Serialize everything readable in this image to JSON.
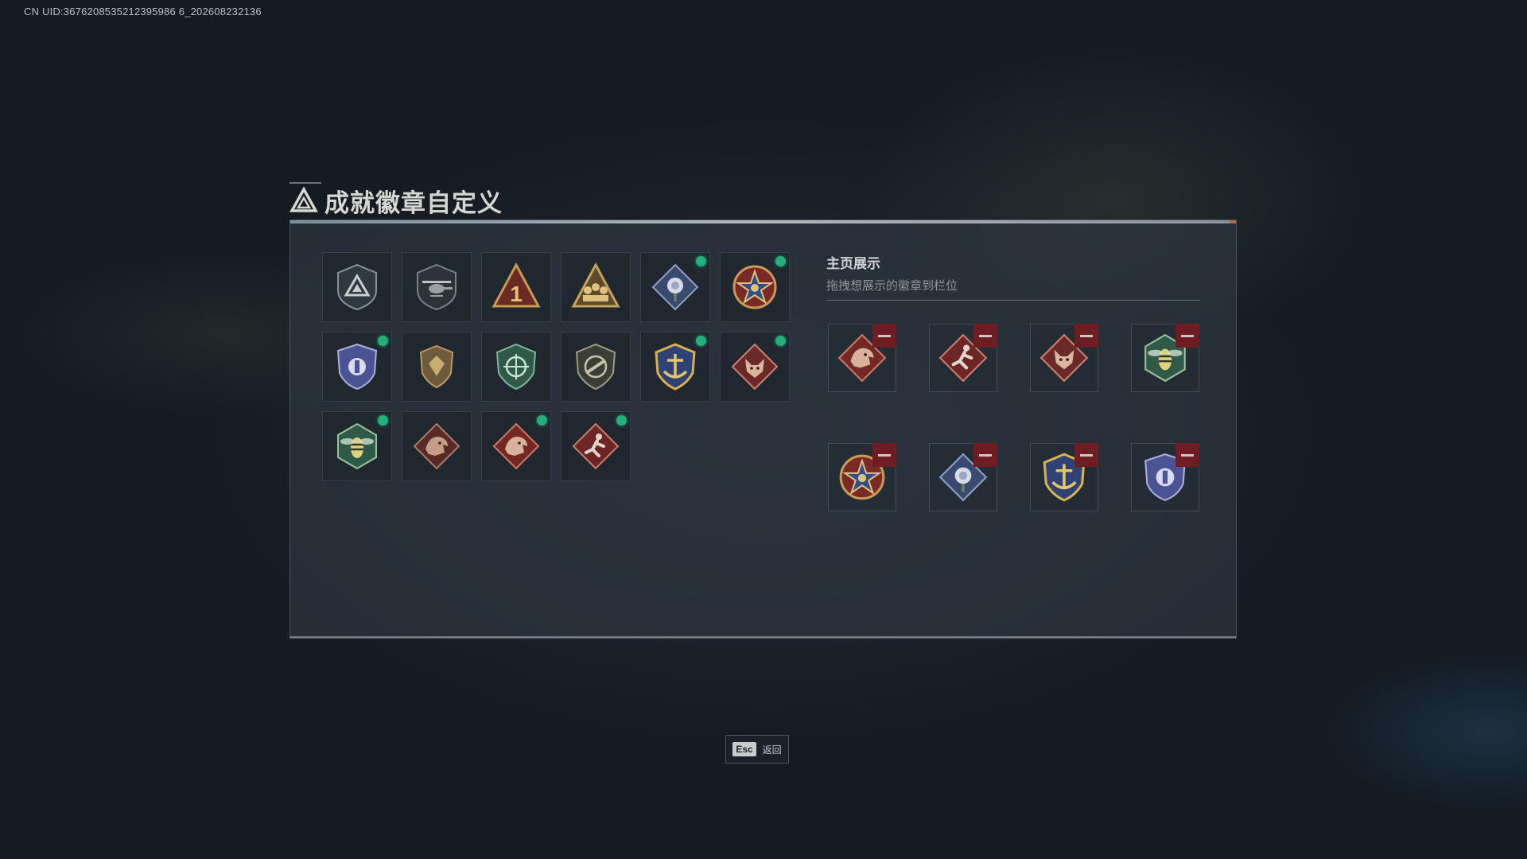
{
  "uid_text": "CN UID:3676208535212395986 6_202608232136",
  "dialog": {
    "title": "成就徽章自定义"
  },
  "collection": {
    "badges": [
      {
        "name": "triangle-emblem-icon",
        "new": false
      },
      {
        "name": "helicopter-badge-icon",
        "new": false
      },
      {
        "name": "rank-one-badge-icon",
        "new": false
      },
      {
        "name": "squad-badge-icon",
        "new": false
      },
      {
        "name": "rose-diamond-badge-icon",
        "new": true
      },
      {
        "name": "star-medal-badge-icon",
        "new": true
      },
      {
        "name": "police-shield-badge-icon",
        "new": true
      },
      {
        "name": "bronze-shield-badge-icon",
        "new": false
      },
      {
        "name": "crosshair-shield-badge-icon",
        "new": false
      },
      {
        "name": "rifle-shield-badge-icon",
        "new": false
      },
      {
        "name": "anchor-gold-badge-icon",
        "new": true
      },
      {
        "name": "wolf-diamond-badge-icon",
        "new": true
      },
      {
        "name": "wasp-hexagon-badge-icon",
        "new": true
      },
      {
        "name": "dragon-diamond-badge-icon",
        "new": false
      },
      {
        "name": "dragon-diamond-red-badge-icon",
        "new": true
      },
      {
        "name": "runner-diamond-badge-icon",
        "new": true
      }
    ]
  },
  "showcase": {
    "title": "主页展示",
    "subtitle": "拖拽想展示的徽章到栏位",
    "slots": [
      {
        "name": "dragon-diamond-red-badge-icon"
      },
      {
        "name": "runner-diamond-badge-icon"
      },
      {
        "name": "wolf-diamond-badge-icon"
      },
      {
        "name": "wasp-hexagon-badge-icon"
      },
      {
        "name": "star-medal-badge-icon"
      },
      {
        "name": "rose-diamond-badge-icon"
      },
      {
        "name": "anchor-gold-badge-icon"
      },
      {
        "name": "police-shield-badge-icon"
      }
    ]
  },
  "footer": {
    "esc_key": "Esc",
    "esc_label": "返回"
  },
  "colors": {
    "new_dot": "#21b07a",
    "remove_button": "#6e1e22",
    "panel_bg": "#2c3640"
  }
}
